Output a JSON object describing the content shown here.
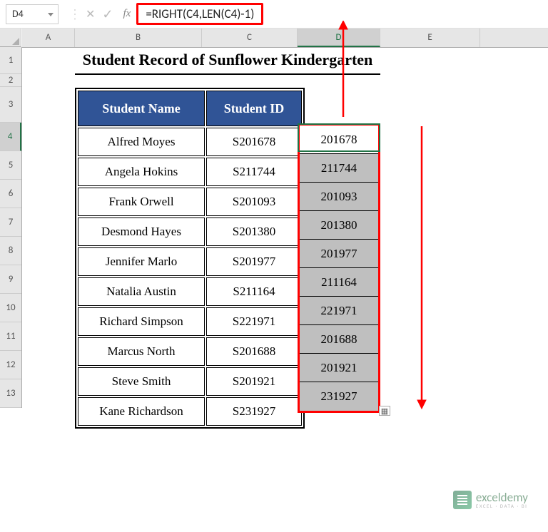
{
  "name_box": "D4",
  "formula": "=RIGHT(C4,LEN(C4)-1)",
  "columns": [
    "A",
    "B",
    "C",
    "D",
    "E"
  ],
  "rows": [
    "1",
    "2",
    "3",
    "4",
    "5",
    "6",
    "7",
    "8",
    "9",
    "10",
    "11",
    "12",
    "13"
  ],
  "selected_col": "D",
  "selected_row": "4",
  "title": "Student Record of Sunflower Kindergarten",
  "headers": {
    "b": "Student Name",
    "c": "Student ID"
  },
  "students": [
    {
      "name": "Alfred Moyes",
      "id": "S201678",
      "result": "201678"
    },
    {
      "name": "Angela Hokins",
      "id": "S211744",
      "result": "211744"
    },
    {
      "name": "Frank Orwell",
      "id": "S201093",
      "result": "201093"
    },
    {
      "name": "Desmond Hayes",
      "id": "S201380",
      "result": "201380"
    },
    {
      "name": "Jennifer Marlo",
      "id": "S201977",
      "result": "201977"
    },
    {
      "name": "Natalia Austin",
      "id": "S211164",
      "result": "211164"
    },
    {
      "name": "Richard Simpson",
      "id": "S221971",
      "result": "221971"
    },
    {
      "name": "Marcus North",
      "id": "S201688",
      "result": "201688"
    },
    {
      "name": "Steve Smith",
      "id": "S201921",
      "result": "201921"
    },
    {
      "name": "Kane Richardson",
      "id": "S231927",
      "result": "231927"
    }
  ],
  "watermark": {
    "brand": "exceldemy",
    "tag": "EXCEL · DATA · BI"
  }
}
